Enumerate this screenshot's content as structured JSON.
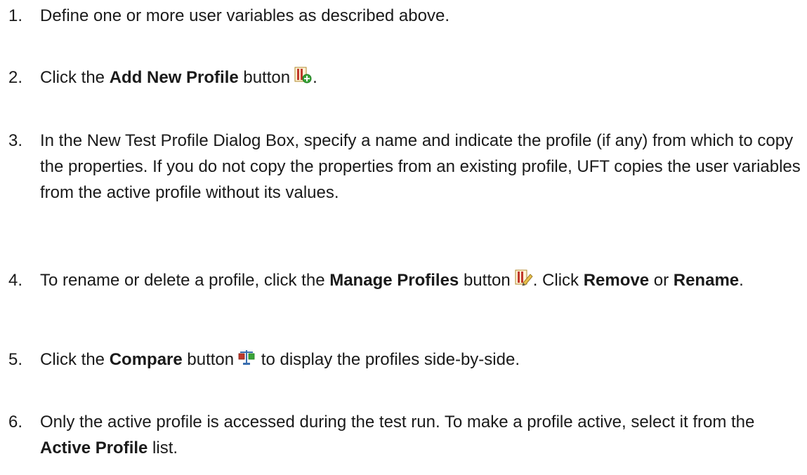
{
  "steps": [
    {
      "number": "1.",
      "text": "Define one or more user variables as described above."
    },
    {
      "number": "2.",
      "pre": "Click the ",
      "bold": "Add New Profile",
      "post": " button",
      "icon": "add-profile-icon",
      "after_icon": "."
    },
    {
      "number": "3.",
      "text": "In the New Test Profile Dialog Box, specify a name and indicate the profile (if any) from which to copy the properties. If you do not copy the properties from an existing profile, UFT copies the user variables from the active profile without its values."
    },
    {
      "number": "4.",
      "pre": "To rename or delete a profile, click the ",
      "bold": "Manage Profiles",
      "post": " button",
      "icon": "manage-profiles-icon",
      "after_icon": ". Click ",
      "bold2": "Remove",
      "mid": " or ",
      "bold3": "Rename",
      "end": "."
    },
    {
      "number": "5.",
      "pre": "Click the ",
      "bold": "Compare",
      "post": " button",
      "icon": "compare-icon",
      "after_icon": " to display the profiles side-by-side."
    },
    {
      "number": "6.",
      "pre": "Only the active profile is accessed during the test run. To make a profile active, select it from the ",
      "bold": "Active Profile",
      "post": " list."
    }
  ],
  "colors": {
    "text": "#1a1a1a",
    "icon_red": "#c0392b",
    "icon_green": "#3aa53a",
    "icon_yellow": "#e8c04a",
    "icon_blue": "#3a6fb0"
  }
}
